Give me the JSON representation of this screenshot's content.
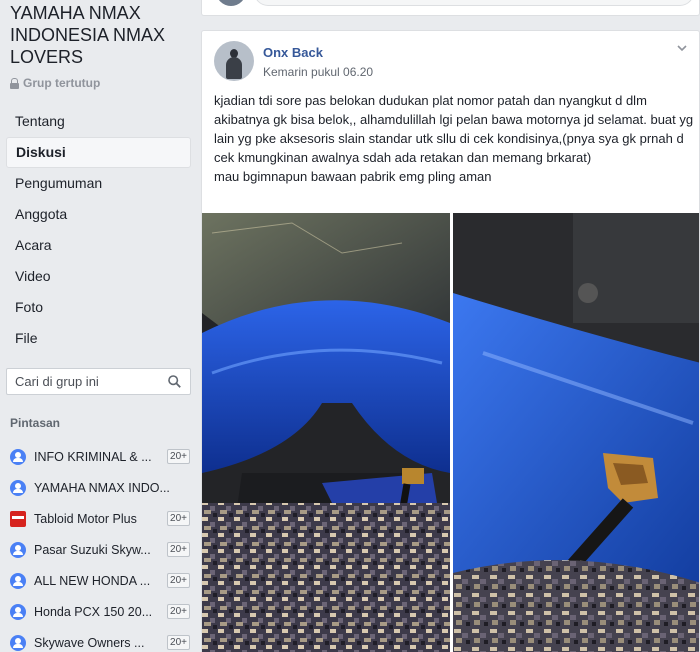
{
  "group": {
    "title": "YAMAHA NMAX INDONESIA NMAX LOVERS",
    "status": "Grup tertutup"
  },
  "nav": [
    {
      "label": "Tentang",
      "active": false
    },
    {
      "label": "Diskusi",
      "active": true
    },
    {
      "label": "Pengumuman",
      "active": false
    },
    {
      "label": "Anggota",
      "active": false
    },
    {
      "label": "Acara",
      "active": false
    },
    {
      "label": "Video",
      "active": false
    },
    {
      "label": "Foto",
      "active": false
    },
    {
      "label": "File",
      "active": false
    }
  ],
  "search": {
    "placeholder": "Cari di grup ini"
  },
  "shortcuts": {
    "title": "Pintasan",
    "items": [
      {
        "label": "INFO KRIMINAL & ...",
        "count": "20+",
        "icon": "group-icon"
      },
      {
        "label": "YAMAHA NMAX INDO...",
        "count": "",
        "icon": "group-icon"
      },
      {
        "label": "Tabloid Motor Plus",
        "count": "20+",
        "icon": "page-icon"
      },
      {
        "label": "Pasar Suzuki Skyw...",
        "count": "20+",
        "icon": "group-icon"
      },
      {
        "label": "ALL NEW HONDA ...",
        "count": "20+",
        "icon": "group-icon"
      },
      {
        "label": "Honda PCX 150 20...",
        "count": "20+",
        "icon": "group-icon"
      },
      {
        "label": "Skywave Owners ...",
        "count": "20+",
        "icon": "group-icon"
      }
    ]
  },
  "post": {
    "author": "Onx Back",
    "timestamp": "Kemarin pukul 06.20",
    "text": "kjadian tdi sore pas belokan dudukan plat nomor patah dan nyangkut d dlm akibatnya gk bisa belok,, alhamdulillah lgi pelan bawa motornya jd selamat. buat yg lain yg pke aksesoris slain standar utk sllu di cek kondisinya,(pnya sya gk prnah d cek kmungkinan awalnya sdah ada retakan dan memang brkarat)\nmau bgimnapun bawaan pabrik emg pling aman"
  },
  "colors": {
    "accent": "#365899",
    "background": "#e9ebee",
    "motorcycle_blue": "#1d4fd1"
  }
}
